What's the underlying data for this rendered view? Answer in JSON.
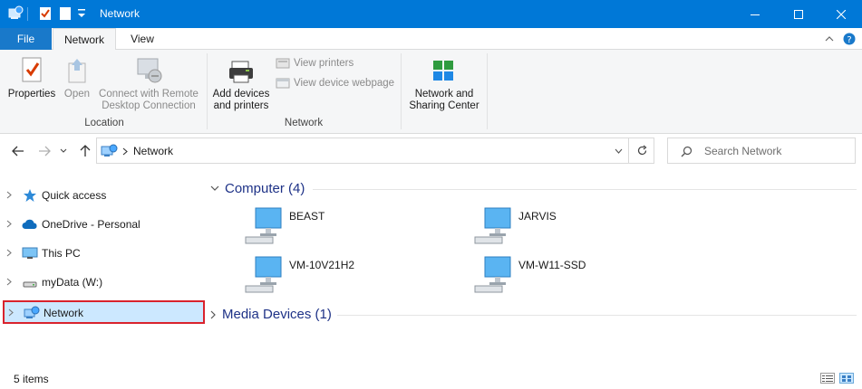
{
  "window": {
    "title": "Network"
  },
  "ribbon_tabs": [
    "File",
    "Network",
    "View"
  ],
  "ribbon": {
    "location_group": {
      "label": "Location",
      "buttons": {
        "properties": "Properties",
        "open": "Open",
        "connect_line1": "Connect with Remote",
        "connect_line2": "Desktop Connection"
      }
    },
    "network_group": {
      "label": "Network",
      "add_devices_line1": "Add devices",
      "add_devices_line2": "and printers",
      "view_printers": "View printers",
      "view_device_webpage": "View device webpage"
    },
    "sharing": {
      "line1": "Network and",
      "line2": "Sharing Center"
    }
  },
  "address": {
    "path": "Network",
    "search_placeholder": "Search Network"
  },
  "sidebar": {
    "items": [
      {
        "label": "Quick access",
        "icon": "star-icon"
      },
      {
        "label": "OneDrive - Personal",
        "icon": "cloud-icon"
      },
      {
        "label": "This PC",
        "icon": "monitor-icon"
      },
      {
        "label": "myData (W:)",
        "icon": "drive-icon"
      },
      {
        "label": "Network",
        "icon": "network-icon",
        "selected": true
      }
    ]
  },
  "content": {
    "computer_group": "Computer (4)",
    "computers": [
      "BEAST",
      "JARVIS",
      "VM-10V21H2",
      "VM-W11-SSD"
    ],
    "media_group": "Media Devices (1)"
  },
  "status": {
    "items": "5 items"
  },
  "colors": {
    "titlebar": "#0078d7",
    "file_tab": "#1979ca",
    "selected": "#cce8ff",
    "highlight_border": "#d9232d",
    "group_heading": "#1e3287"
  }
}
